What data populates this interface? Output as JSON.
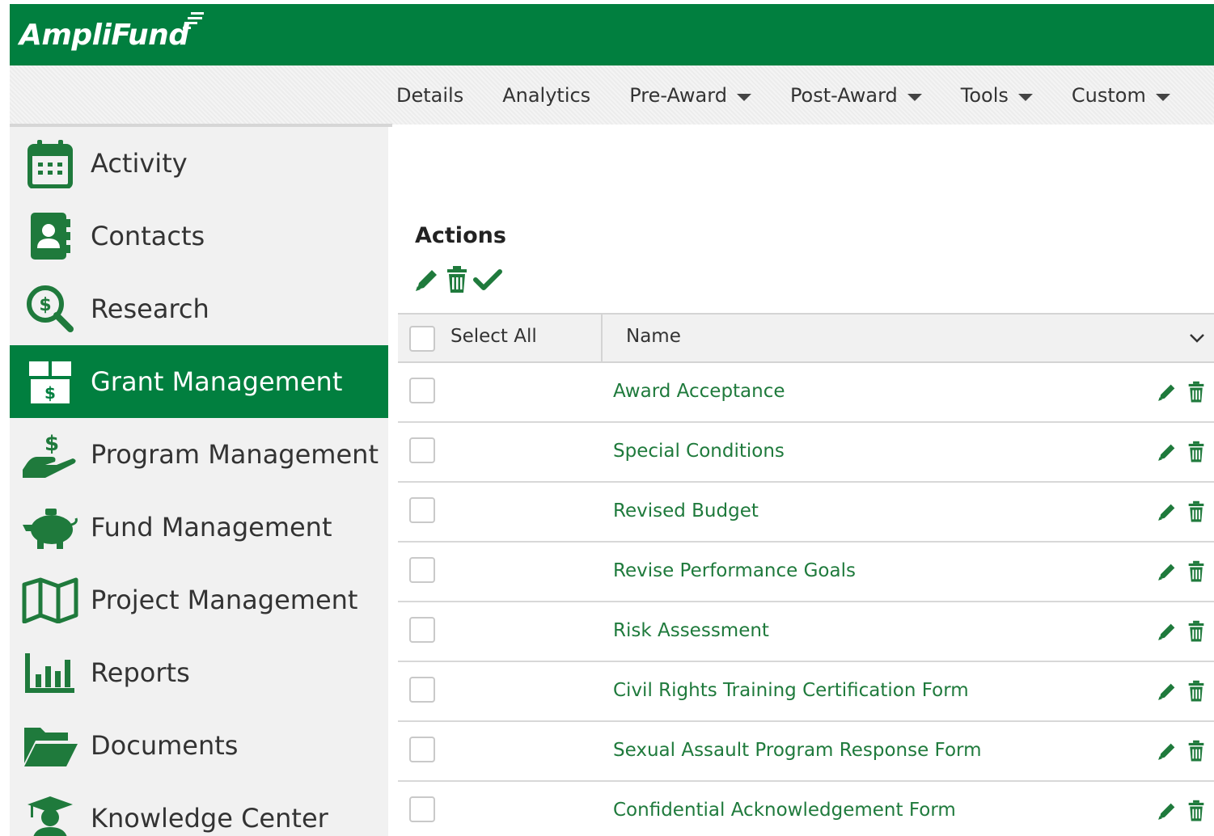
{
  "app": {
    "logo": "AmpliFund",
    "brand_color": "#017f3f"
  },
  "topnav": [
    {
      "label": "Details",
      "dropdown": false
    },
    {
      "label": "Analytics",
      "dropdown": false
    },
    {
      "label": "Pre-Award",
      "dropdown": true
    },
    {
      "label": "Post-Award",
      "dropdown": true
    },
    {
      "label": "Tools",
      "dropdown": true
    },
    {
      "label": "Custom",
      "dropdown": true
    }
  ],
  "sidebar": {
    "items": [
      {
        "label": "Activity",
        "icon": "calendar-icon",
        "active": false
      },
      {
        "label": "Contacts",
        "icon": "address-book-icon",
        "active": false
      },
      {
        "label": "Research",
        "icon": "search-dollar-icon",
        "active": false
      },
      {
        "label": "Grant Management",
        "icon": "box-dollar-icon",
        "active": true
      },
      {
        "label": "Program Management",
        "icon": "hand-dollar-icon",
        "active": false
      },
      {
        "label": "Fund Management",
        "icon": "piggy-bank-icon",
        "active": false
      },
      {
        "label": "Project Management",
        "icon": "map-icon",
        "active": false
      },
      {
        "label": "Reports",
        "icon": "bar-chart-icon",
        "active": false
      },
      {
        "label": "Documents",
        "icon": "folder-open-icon",
        "active": false
      },
      {
        "label": "Knowledge Center",
        "icon": "graduate-icon",
        "active": false
      }
    ]
  },
  "actions": {
    "title": "Actions",
    "icons": [
      "pencil-icon",
      "trash-icon",
      "check-icon"
    ]
  },
  "grid": {
    "select_all_label": "Select All",
    "name_header": "Name",
    "rows": [
      {
        "name": "Award Acceptance"
      },
      {
        "name": "Special Conditions"
      },
      {
        "name": "Revised Budget"
      },
      {
        "name": "Revise Performance Goals"
      },
      {
        "name": "Risk Assessment"
      },
      {
        "name": "Civil Rights Training Certification Form"
      },
      {
        "name": "Sexual Assault Program Response Form"
      },
      {
        "name": "Confidential Acknowledgement Form"
      }
    ]
  }
}
